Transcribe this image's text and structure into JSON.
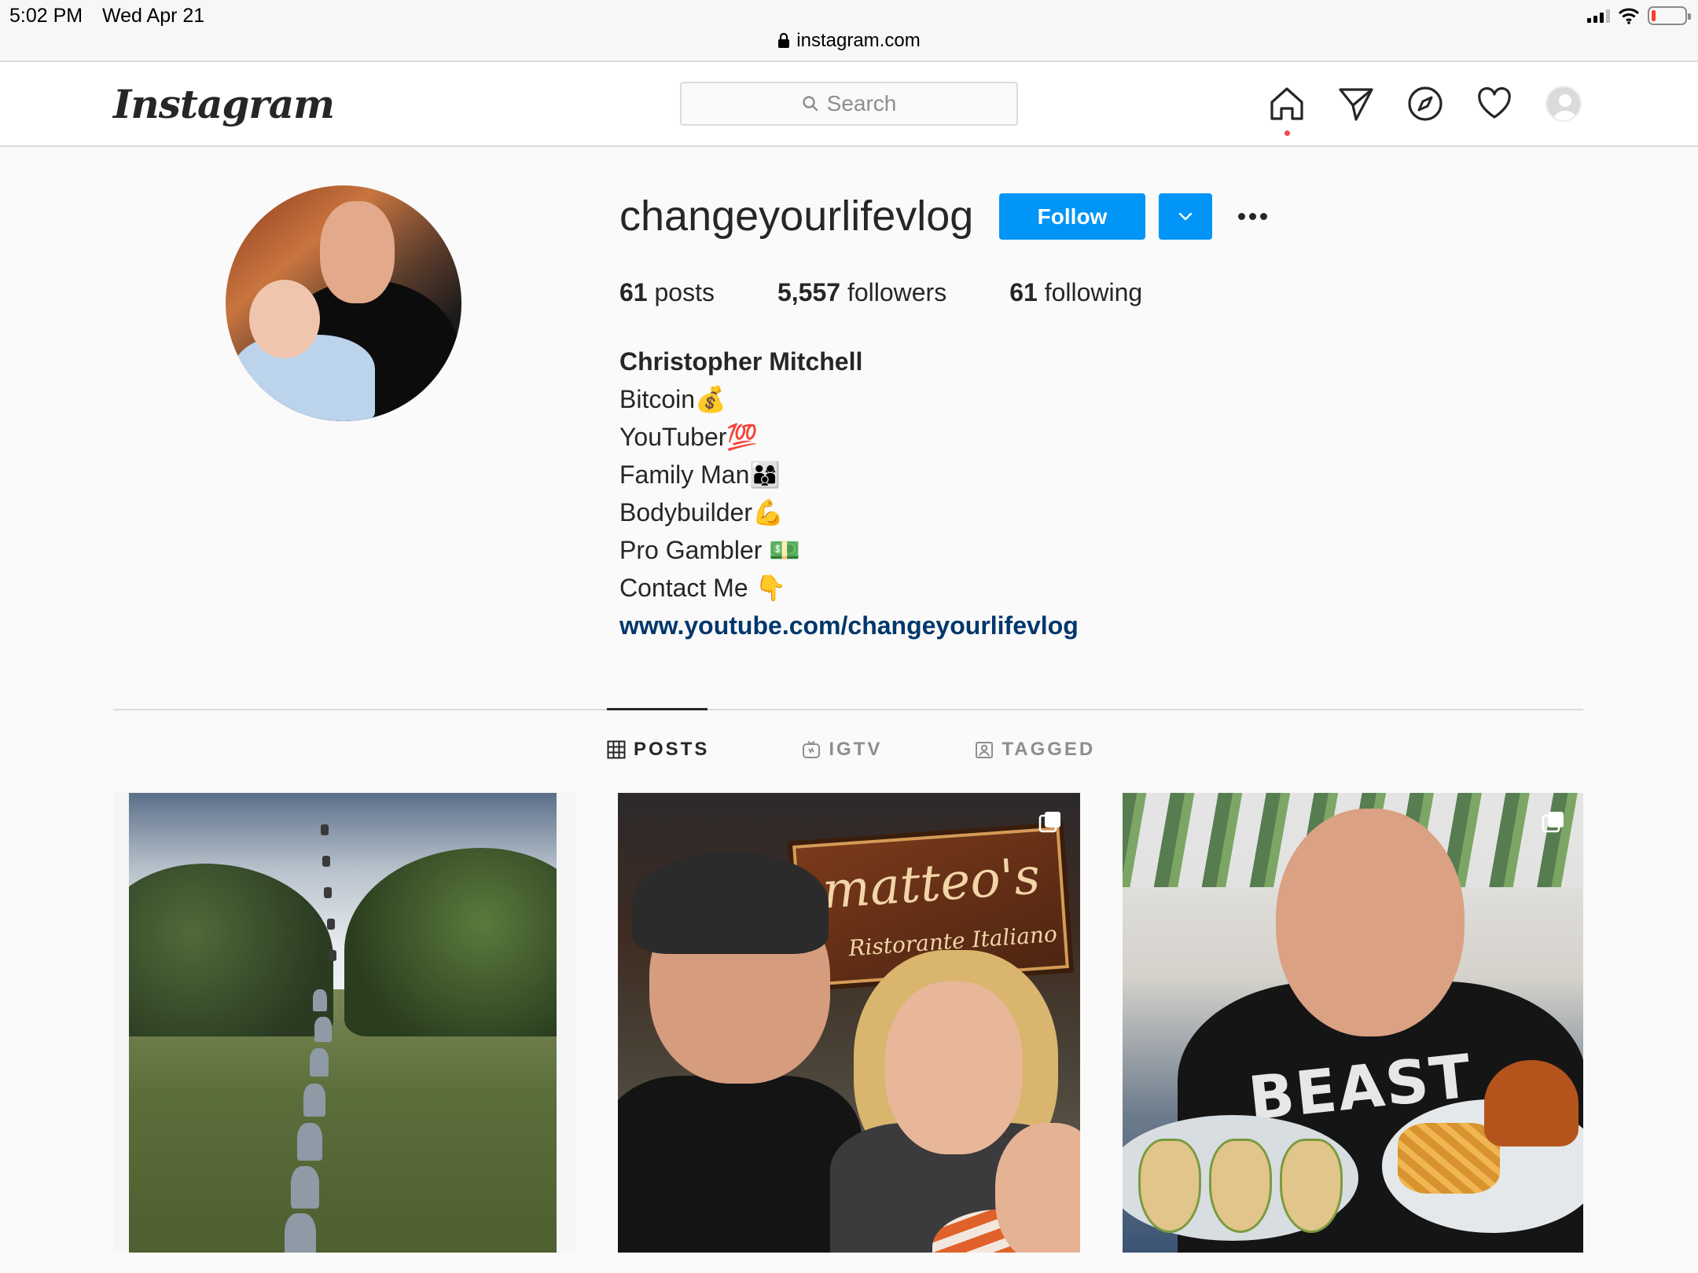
{
  "status_bar": {
    "time": "5:02 PM",
    "date": "Wed Apr 21",
    "url": "instagram.com"
  },
  "nav": {
    "logo": "Instagram",
    "search_placeholder": "Search",
    "icons": [
      "home-icon",
      "direct-icon",
      "explore-icon",
      "activity-heart-icon",
      "profile-avatar"
    ]
  },
  "profile": {
    "username": "changeyourlifevlog",
    "follow_label": "Follow",
    "stats": {
      "posts_count": "61",
      "posts_label": "posts",
      "followers_count": "5,557",
      "followers_label": "followers",
      "following_count": "61",
      "following_label": "following"
    },
    "bio": {
      "name": "Christopher Mitchell",
      "lines": [
        "Bitcoin💰",
        "YouTuber💯",
        "Family Man👨‍👩‍👦",
        "Bodybuilder💪",
        "Pro Gambler 💵",
        "Contact Me 👇"
      ],
      "link": "www.youtube.com/changeyourlifevlog"
    }
  },
  "tabs": [
    {
      "label": "POSTS",
      "icon": "grid-icon",
      "active": true
    },
    {
      "label": "IGTV",
      "icon": "igtv-icon",
      "active": false
    },
    {
      "label": "TAGGED",
      "icon": "tagged-icon",
      "active": false
    }
  ],
  "posts": [
    {
      "multi": false
    },
    {
      "multi": true,
      "sign_title": "matteo's",
      "sign_subtitle": "Ristorante Italiano"
    },
    {
      "multi": true,
      "shirt_text": "BEAST"
    }
  ],
  "colors": {
    "accent": "#0095f6",
    "link": "#00376b",
    "notification_dot": "#ed4956"
  }
}
